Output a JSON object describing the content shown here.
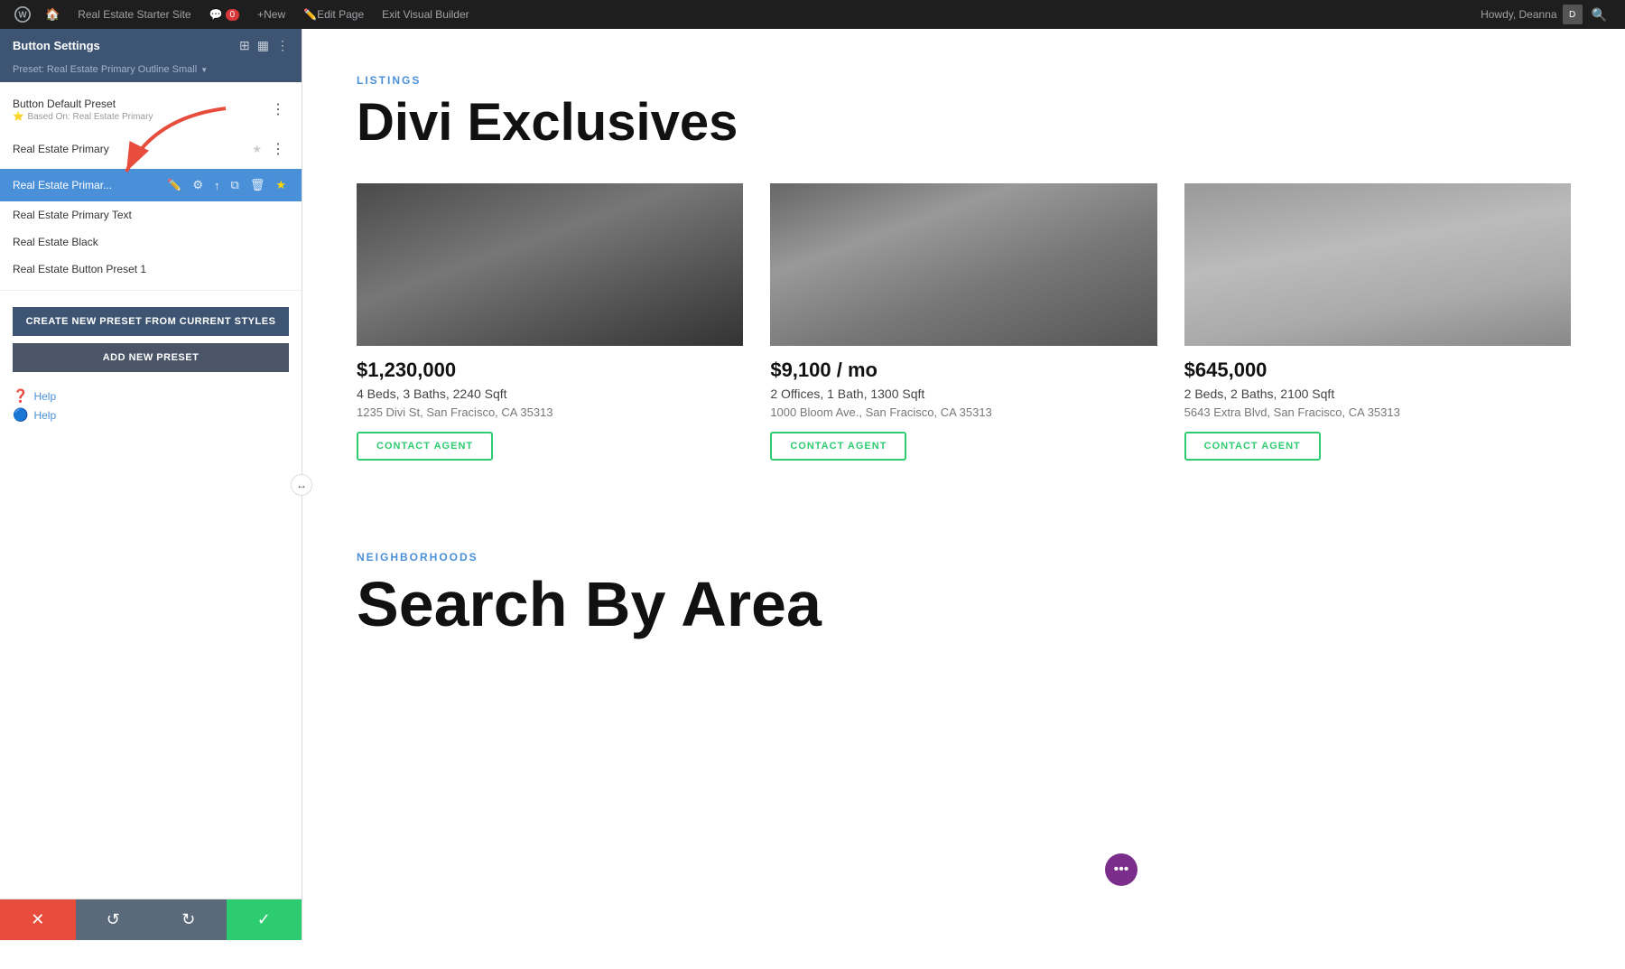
{
  "admin_bar": {
    "site_name": "Real Estate Starter Site",
    "comment_count": "0",
    "new_label": "New",
    "edit_page_label": "Edit Page",
    "exit_builder_label": "Exit Visual Builder",
    "howdy_text": "Howdy, Deanna"
  },
  "panel": {
    "title": "Button Settings",
    "preset_subtitle": "Preset: Real Estate Primary Outline Small",
    "presets": [
      {
        "id": "default",
        "label": "Button Default Preset",
        "sub": "Based On: Real Estate Primary",
        "starred": true,
        "active": false
      },
      {
        "id": "primary",
        "label": "Real Estate Primary",
        "starred": true,
        "active": false
      },
      {
        "id": "primary_outline",
        "label": "Real Estate Primar...",
        "starred": true,
        "active": true
      },
      {
        "id": "primary_text",
        "label": "Real Estate Primary Text",
        "starred": false,
        "active": false
      },
      {
        "id": "black",
        "label": "Real Estate Black",
        "starred": false,
        "active": false
      },
      {
        "id": "preset1",
        "label": "Real Estate Button Preset 1",
        "starred": false,
        "active": false
      }
    ],
    "active_preset_name": "Real Estate Primar...",
    "create_btn": "CREATE NEW PRESET FROM CURRENT STYLES",
    "add_btn": "ADD NEW PRESET",
    "help_label": "Help",
    "help_label2": "Help"
  },
  "bottom_bar": {
    "cancel_icon": "✕",
    "undo_icon": "↺",
    "redo_icon": "↻",
    "save_icon": "✓"
  },
  "content": {
    "listings_label": "LISTINGS",
    "listings_title": "Divi Exclusives",
    "neighborhoods_label": "NEIGHBORHOODS",
    "neighborhoods_title": "Search By Area",
    "properties": [
      {
        "price": "$1,230,000",
        "details": "4 Beds, 3 Baths, 2240 Sqft",
        "address": "1235 Divi St, San Fracisco, CA 35313",
        "contact_btn": "CONTACT AGENT",
        "img_class": "img1"
      },
      {
        "price": "$9,100 / mo",
        "details": "2 Offices, 1 Bath, 1300 Sqft",
        "address": "1000 Bloom Ave., San Fracisco, CA 35313",
        "contact_btn": "CONTACT AGENT",
        "img_class": "img2"
      },
      {
        "price": "$645,000",
        "details": "2 Beds, 2 Baths, 2100 Sqft",
        "address": "5643 Extra Blvd, San Fracisco, CA 35313",
        "contact_btn": "CONTACT AGENT",
        "img_class": "img3"
      }
    ]
  }
}
